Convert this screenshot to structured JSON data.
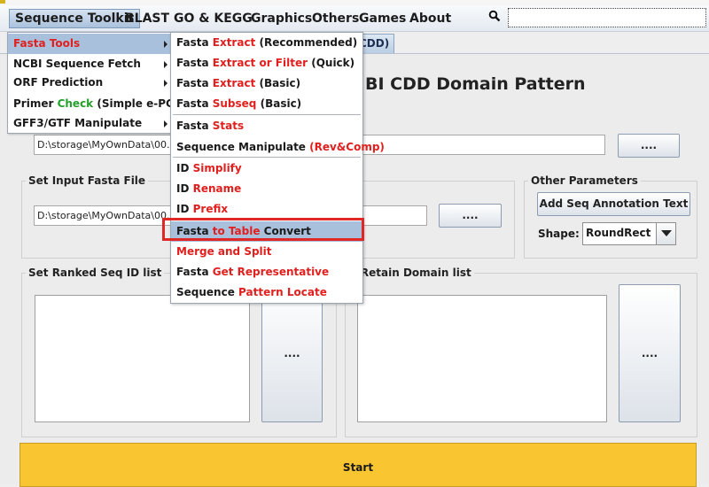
{
  "menubar": {
    "items": [
      "Sequence Toolkit",
      "BLAST",
      "GO & KEGG",
      "Graphics",
      "Others",
      "Games",
      "About"
    ]
  },
  "tab": {
    "label": "CDD)"
  },
  "panel": {
    "title": "BI CDD Domain Pattern",
    "path1": "D:\\storage\\MyOwnData\\00.L",
    "browse1": "....",
    "input_fasta": {
      "legend": "Set Input Fasta File",
      "path": "D:\\storage\\MyOwnData\\00.",
      "browse": "...."
    },
    "other_params": {
      "legend": "Other Parameters",
      "add_button": "Add Seq Annotation Text",
      "shape_label": "Shape:",
      "shape_value": "RoundRect"
    },
    "ranked": {
      "legend": "Set Ranked Seq ID list",
      "browse": "...."
    },
    "retain": {
      "legend": "t Retain Domain list",
      "browse": "...."
    },
    "start": "Start"
  },
  "menu_sequence_toolkit": [
    {
      "parts": [
        {
          "t": "Fasta Tools",
          "c": "red"
        }
      ],
      "submenu": true,
      "highlighted": true
    },
    {
      "parts": [
        {
          "t": "NCBI Sequence Fetch",
          "c": ""
        }
      ],
      "submenu": true
    },
    {
      "parts": [
        {
          "t": "ORF Prediction",
          "c": ""
        }
      ],
      "submenu": true
    },
    {
      "parts": [
        {
          "t": "Primer ",
          "c": ""
        },
        {
          "t": "Check",
          "c": "green"
        },
        {
          "t": " (Simple e-PCR)",
          "c": ""
        }
      ],
      "submenu": false
    },
    {
      "parts": [
        {
          "t": "GFF3/GTF Manipulate",
          "c": ""
        }
      ],
      "submenu": true
    }
  ],
  "menu_fasta_tools": [
    [
      {
        "t": "Fasta ",
        "c": ""
      },
      {
        "t": "Extract",
        "c": "red"
      },
      {
        "t": " (Recommended)",
        "c": ""
      }
    ],
    [
      {
        "t": "Fasta ",
        "c": ""
      },
      {
        "t": "Extract or Filter",
        "c": "red"
      },
      {
        "t": " (Quick)",
        "c": ""
      }
    ],
    [
      {
        "t": "Fasta ",
        "c": ""
      },
      {
        "t": "Extract",
        "c": "red"
      },
      {
        "t": " (Basic)",
        "c": ""
      }
    ],
    [
      {
        "t": "Fasta ",
        "c": ""
      },
      {
        "t": "Subseq",
        "c": "red"
      },
      {
        "t": " (Basic)",
        "c": ""
      }
    ],
    [
      {
        "t": "Fasta ",
        "c": ""
      },
      {
        "t": "Stats",
        "c": "red"
      }
    ],
    [
      {
        "t": "Sequence Manipulate ",
        "c": ""
      },
      {
        "t": "(Rev&Comp)",
        "c": "red"
      }
    ],
    [
      {
        "t": "ID ",
        "c": ""
      },
      {
        "t": "Simplify",
        "c": "red"
      }
    ],
    [
      {
        "t": "ID ",
        "c": ""
      },
      {
        "t": "Rename",
        "c": "red"
      }
    ],
    [
      {
        "t": "ID ",
        "c": ""
      },
      {
        "t": "Prefix",
        "c": "red"
      }
    ],
    [
      {
        "t": "Fasta ",
        "c": ""
      },
      {
        "t": "to Table",
        "c": "red"
      },
      {
        "t": " Convert",
        "c": ""
      }
    ],
    [
      {
        "t": "Merge and Split",
        "c": "red"
      }
    ],
    [
      {
        "t": "Fasta ",
        "c": ""
      },
      {
        "t": "Get Representative",
        "c": "red"
      }
    ],
    [
      {
        "t": "Sequence ",
        "c": ""
      },
      {
        "t": "Pattern Locate",
        "c": "red"
      }
    ]
  ]
}
